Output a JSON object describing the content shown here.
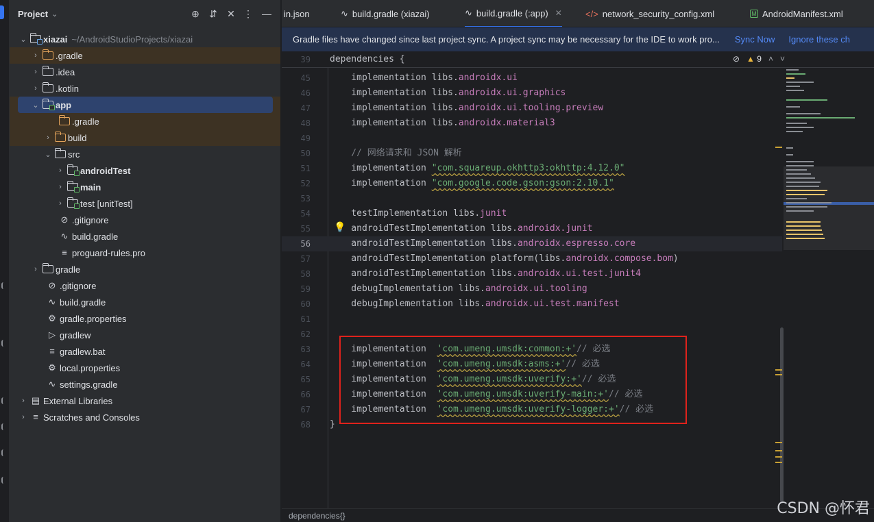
{
  "project_panel": {
    "title": "Project",
    "tree": [
      {
        "label": "xiazai",
        "muted": "~/AndroidStudioProjects/xiazai",
        "bold": true
      },
      {
        "label": ".gradle"
      },
      {
        "label": ".idea"
      },
      {
        "label": ".kotlin"
      },
      {
        "label": "app",
        "bold": true
      },
      {
        "label": ".gradle"
      },
      {
        "label": "build"
      },
      {
        "label": "src"
      },
      {
        "label": "androidTest",
        "bold": true
      },
      {
        "label": "main",
        "bold": true
      },
      {
        "label": "test [unitTest]",
        "bold": true
      },
      {
        "label": ".gitignore"
      },
      {
        "label": "build.gradle"
      },
      {
        "label": "proguard-rules.pro"
      },
      {
        "label": "gradle"
      },
      {
        "label": ".gitignore"
      },
      {
        "label": "build.gradle"
      },
      {
        "label": "gradle.properties"
      },
      {
        "label": "gradlew"
      },
      {
        "label": "gradlew.bat"
      },
      {
        "label": "local.properties"
      },
      {
        "label": "settings.gradle"
      },
      {
        "label": "External Libraries"
      },
      {
        "label": "Scratches and Consoles"
      }
    ]
  },
  "tabs": [
    {
      "label": "in.json"
    },
    {
      "label": "build.gradle (xiazai)"
    },
    {
      "label": "build.gradle (:app)",
      "active": true
    },
    {
      "label": "network_security_config.xml"
    },
    {
      "label": "AndroidManifest.xml"
    }
  ],
  "banner": {
    "message": "Gradle files have changed since last project sync. A project sync may be necessary for the IDE to work pro...",
    "sync_now": "Sync Now",
    "ignore": "Ignore these ch"
  },
  "editor": {
    "warning_count": "9",
    "sticky": {
      "num": "39",
      "text": "dependencies {"
    },
    "lines": [
      {
        "num": "45",
        "plain": "    implementation libs.",
        "prop": "androidx.ui"
      },
      {
        "num": "46",
        "plain": "    implementation libs.",
        "prop": "androidx.ui.graphics"
      },
      {
        "num": "47",
        "plain": "    implementation libs.",
        "prop": "androidx.ui.tooling.preview"
      },
      {
        "num": "48",
        "plain": "    implementation libs.",
        "prop": "androidx.material3"
      },
      {
        "num": "49"
      },
      {
        "num": "50",
        "comment": "    // 网络请求和 JSON 解析"
      },
      {
        "num": "51",
        "plain": "    implementation ",
        "str": "\"com.squareup.okhttp3:okhttp:4.12.0\""
      },
      {
        "num": "52",
        "plain": "    implementation ",
        "str": "\"com.google.code.gson:gson:2.10.1\""
      },
      {
        "num": "53"
      },
      {
        "num": "54",
        "plain": "    testImplementation libs.",
        "prop": "junit"
      },
      {
        "num": "55",
        "plain": "    androidTestImplementation libs.",
        "prop": "androidx.junit"
      },
      {
        "num": "56",
        "plain": "    androidTestImplementation libs.",
        "prop": "androidx.espresso.core",
        "current": true
      },
      {
        "num": "57",
        "plain": "    androidTestImplementation platform(libs.",
        "prop": "androidx.compose.bom",
        "after": ")"
      },
      {
        "num": "58",
        "plain": "    androidTestImplementation libs.",
        "prop": "androidx.ui.test.junit4"
      },
      {
        "num": "59",
        "plain": "    debugImplementation libs.",
        "prop": "androidx.ui.tooling"
      },
      {
        "num": "60",
        "plain": "    debugImplementation libs.",
        "prop": "androidx.ui.test.manifest"
      },
      {
        "num": "61"
      },
      {
        "num": "62"
      },
      {
        "num": "63",
        "plain": "    implementation  ",
        "str": "'com.umeng.umsdk:common:+'",
        "comment": "// 必选"
      },
      {
        "num": "64",
        "plain": "    implementation  ",
        "str": "'com.umeng.umsdk:asms:+'",
        "comment": "// 必选"
      },
      {
        "num": "65",
        "plain": "    implementation  ",
        "str": "'com.umeng.umsdk:uverify:+'",
        "comment": "// 必选"
      },
      {
        "num": "66",
        "plain": "    implementation  ",
        "str": "'com.umeng.umsdk:uverify-main:+'",
        "comment": "// 必选"
      },
      {
        "num": "67",
        "plain": "    implementation  ",
        "str": "'com.umeng.umsdk:uverify-logger:+'",
        "comment": "// 必选"
      },
      {
        "num": "68",
        "plain": "}"
      }
    ]
  },
  "breadcrumb": "dependencies{}",
  "watermark": "CSDN @怀君"
}
